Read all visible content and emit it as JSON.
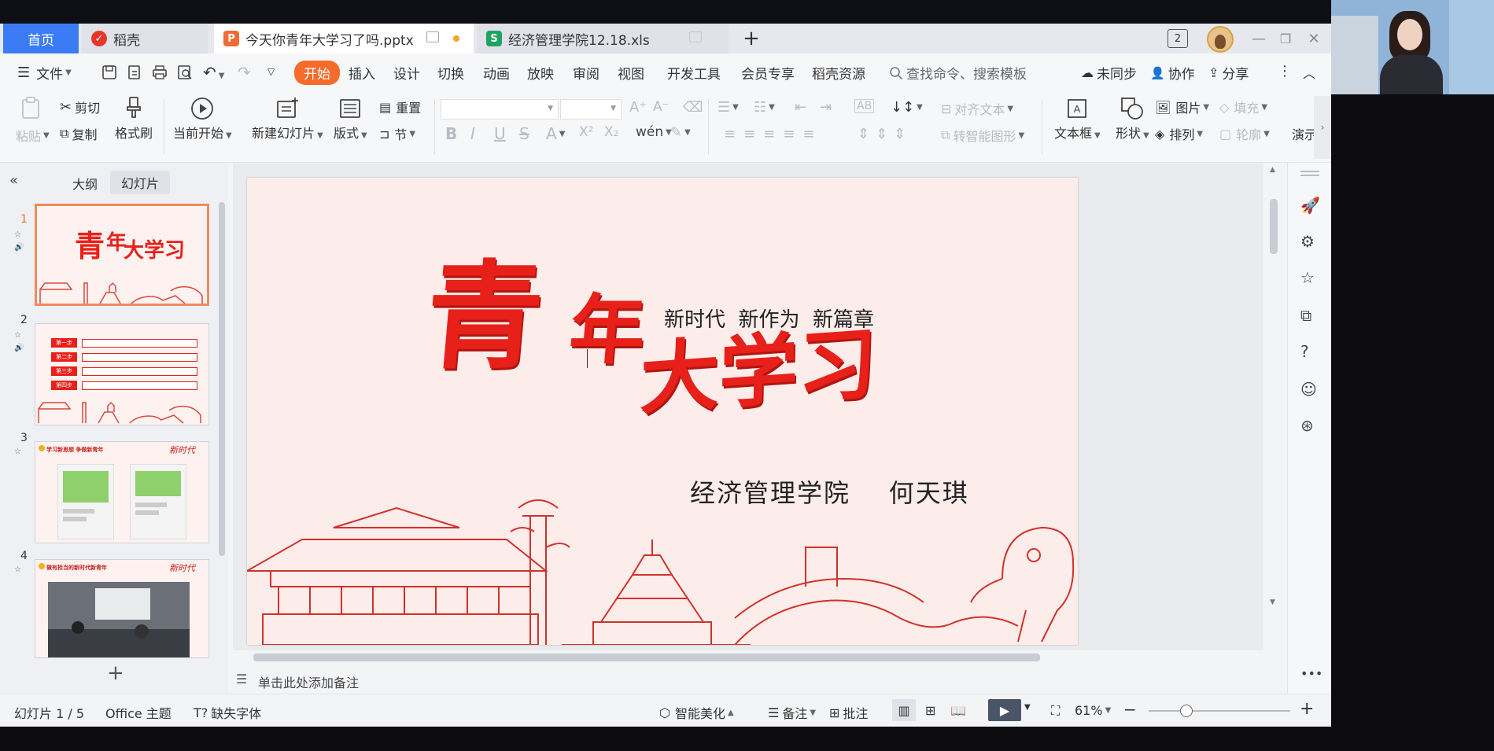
{
  "tabs": {
    "home": "首页",
    "daoke": "稻壳",
    "file1": "今天你青年大学习了吗.pptx",
    "file2": "经济管理学院12.18.xls",
    "window_count": "2"
  },
  "menu": {
    "file": "文件",
    "items": [
      "开始",
      "插入",
      "设计",
      "切换",
      "动画",
      "放映",
      "审阅",
      "视图",
      "开发工具",
      "会员专享",
      "稻壳资源"
    ],
    "search_placeholder": "查找命令、搜索模板",
    "sync": "未同步",
    "collab": "协作",
    "share": "分享"
  },
  "ribbon": {
    "paste": "粘贴",
    "cut": "剪切",
    "copy": "复制",
    "format_painter": "格式刷",
    "play_from_current": "当前开始",
    "new_slide": "新建幻灯片",
    "layout": "版式",
    "reset": "重置",
    "section": "节",
    "align_text": "对齐文本",
    "smart_shape": "转智能图形",
    "textbox": "文本框",
    "shape": "形状",
    "picture": "图片",
    "arrange": "排列",
    "fill": "填充",
    "outline": "轮廓",
    "perform": "演示"
  },
  "leftpanel": {
    "outline_tab": "大纲",
    "slides_tab": "幻灯片",
    "slide_numbers": [
      "1",
      "2",
      "3",
      "4"
    ]
  },
  "slide": {
    "title_char1": "青",
    "title_char2": "年",
    "title_rest": "大学习",
    "subtitle": "新时代  新作为  新篇章",
    "author_line": "经济管理学院    何天琪"
  },
  "thumb2_items": [
    "第一步",
    "第二步",
    "第三步",
    "第四步"
  ],
  "thumb3_title": "学习新思想  争做新青年",
  "thumb4_title": "做有担当的新时代新青年",
  "notes_placeholder": "单击此处添加备注",
  "status": {
    "slide_counter": "幻灯片 1 / 5",
    "theme": "Office 主题",
    "missing_font": "缺失字体",
    "beautify": "智能美化",
    "notes": "备注",
    "comments": "批注",
    "zoom": "61%"
  },
  "colors": {
    "accent_orange": "#f56c2a",
    "home_tab_blue": "#3b7cf5",
    "slide_red": "#e8201a",
    "slide_bg": "#fcecea"
  }
}
